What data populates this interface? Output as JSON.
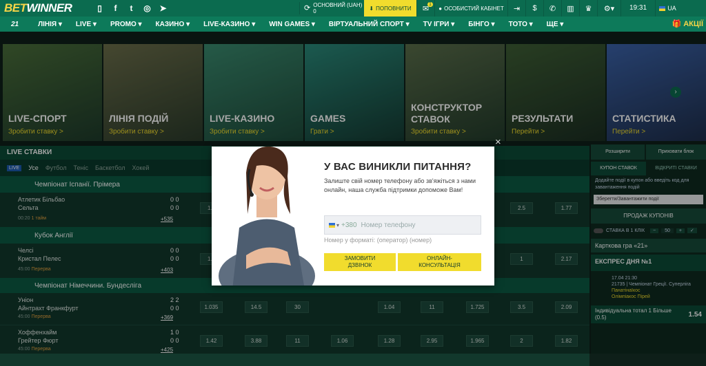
{
  "header": {
    "logo_a": "BET",
    "logo_b": "WINNER",
    "account_label": "ОСНОВНИЙ (UAH)",
    "account_balance": "0",
    "deposit_label": "ПОПОВНИТИ",
    "messages_count": "1",
    "cabinet_label": "ОСОБИСТИЙ КАБІНЕТ",
    "time": "19:31",
    "lang": "UA"
  },
  "nav": {
    "items": [
      "21",
      "ЛІНІЯ ▾",
      "LIVE ▾",
      "PROMO ▾",
      "КАЗИНО ▾",
      "LIVE-КАЗИНО ▾",
      "WIN GAMES ▾",
      "ВІРТУАЛЬНИЙ СПОРТ ▾",
      "TV ІГРИ ▾",
      "БІНГО ▾",
      "ТОТО ▾",
      "ЩЕ ▾"
    ],
    "promo": "АКЦІЇ"
  },
  "tiles": [
    {
      "title": "LIVE-СПОРТ",
      "sub": "Зробити ставку >",
      "color": "#2f5a33"
    },
    {
      "title": "ЛІНІЯ ПОДІЙ",
      "sub": "Зробити ставку >",
      "color": "#4a5a3c"
    },
    {
      "title": "LIVE-КАЗИНО",
      "sub": "Зробити ставку >",
      "color": "#2b6b53"
    },
    {
      "title": "GAMES",
      "sub": "Грати >",
      "color": "#1f6a5a"
    },
    {
      "title": "КОНСТРУКТОР СТАВОК",
      "sub": "Зробити ставку >",
      "color": "#3d5a40"
    },
    {
      "title": "РЕЗУЛЬТАТИ",
      "sub": "Перейти >",
      "color": "#2a4a30"
    },
    {
      "title": "СТАТИСТИКА",
      "sub": "Перейти >",
      "color": "#35568a"
    }
  ],
  "live": {
    "title": "LIVE СТАВКИ",
    "tabs": [
      "Усе",
      "Футбол",
      "Теніс",
      "Баскетбол",
      "Хокей"
    ],
    "total_label": "ТОТАЛ",
    "m_label": "М",
    "search_placeholder": "Пошук..."
  },
  "events": [
    {
      "champ": "Чемпіонат Іспанії. Прімера",
      "t1": "Атлетик Більбао",
      "t2": "Сельта",
      "time": "00:20",
      "half": "1 тайм",
      "more": "+535",
      "s1": "0  0",
      "s2": "0  0",
      "o1": "1.8",
      "o2": "2.5",
      "o3": "1.77"
    },
    {
      "champ": "Кубок Англії",
      "t1": "Челсі",
      "t2": "Кристал Пелес",
      "time": "45:00",
      "half": "Перерва",
      "more": "+403",
      "s1": "0  0",
      "s2": "0  0",
      "o1": "1.4",
      "o2": "1",
      "o3": "2.17"
    },
    {
      "champ": "Чемпіонат Німеччини. Бундесліга",
      "t1": "Уніон",
      "t2": "Айнтрахт Франкфурт",
      "time": "45:00",
      "half": "Перерва",
      "more": "+369",
      "s1": "2  2",
      "s2": "0  0",
      "o1": "1.035",
      "o2": "14.5",
      "o3": "30",
      "o4": "1.04",
      "o5": "11",
      "o6": "1.725",
      "o7": "3.5",
      "o8": "2.09"
    },
    {
      "champ": "",
      "t1": "Хоффенхайм",
      "t2": "Грейтер Фюрт",
      "time": "45:00",
      "half": "Перерва",
      "more": "+425",
      "s1": "1  0",
      "s2": "0  0",
      "o1": "1.42",
      "o2": "3.88",
      "o3": "11",
      "o4": "1.06",
      "o5": "1.28",
      "o6": "2.95",
      "o7": "1.965",
      "o8": "2",
      "o9": "1.82"
    }
  ],
  "right": {
    "btn1": "Розширити",
    "btn2": "Приховати блок",
    "coupon_tab": "КУПОН СТАВОК",
    "open_tab": "ВІДКРИТІ СТАВКИ",
    "coupon_hint": "Додайте події в купон або введіть код для завантаження подій",
    "save_load": "Зберегти/Завантажити події",
    "sell": "ПРОДАЖ КУПОНІВ",
    "one_click": "СТАВКА В 1 КЛІК",
    "stake": "50",
    "card_game": "Карткова гра «21»",
    "express": "ЕКСПРЕС ДНЯ №1",
    "ex_date": "17.04 21:30",
    "ex_league": "21735 | Чемпіонат Греції. Суперліга",
    "ex_team1": "Панатінаїкос",
    "ex_team2": "Олімпіакос Пірей",
    "ex_bet": "Індивідуальна тотал 1 Більше (0.5)",
    "ex_odd": "1.54"
  },
  "modal": {
    "title": "У ВАС ВИНИКЛИ ПИТАННЯ?",
    "text": "Залиште свій номер телефону або зв'яжіться з нами онлайн, наша служба підтримки допоможе Вам!",
    "code": "+380",
    "placeholder": "Номер телефону",
    "hint": "Номер у форматі: (оператор) (номер)",
    "btn_call": "ЗАМОВИТИ ДЗВІНОК",
    "btn_online": "ОНЛАЙН-КОНСУЛЬТАЦІЯ",
    "close": "×"
  }
}
